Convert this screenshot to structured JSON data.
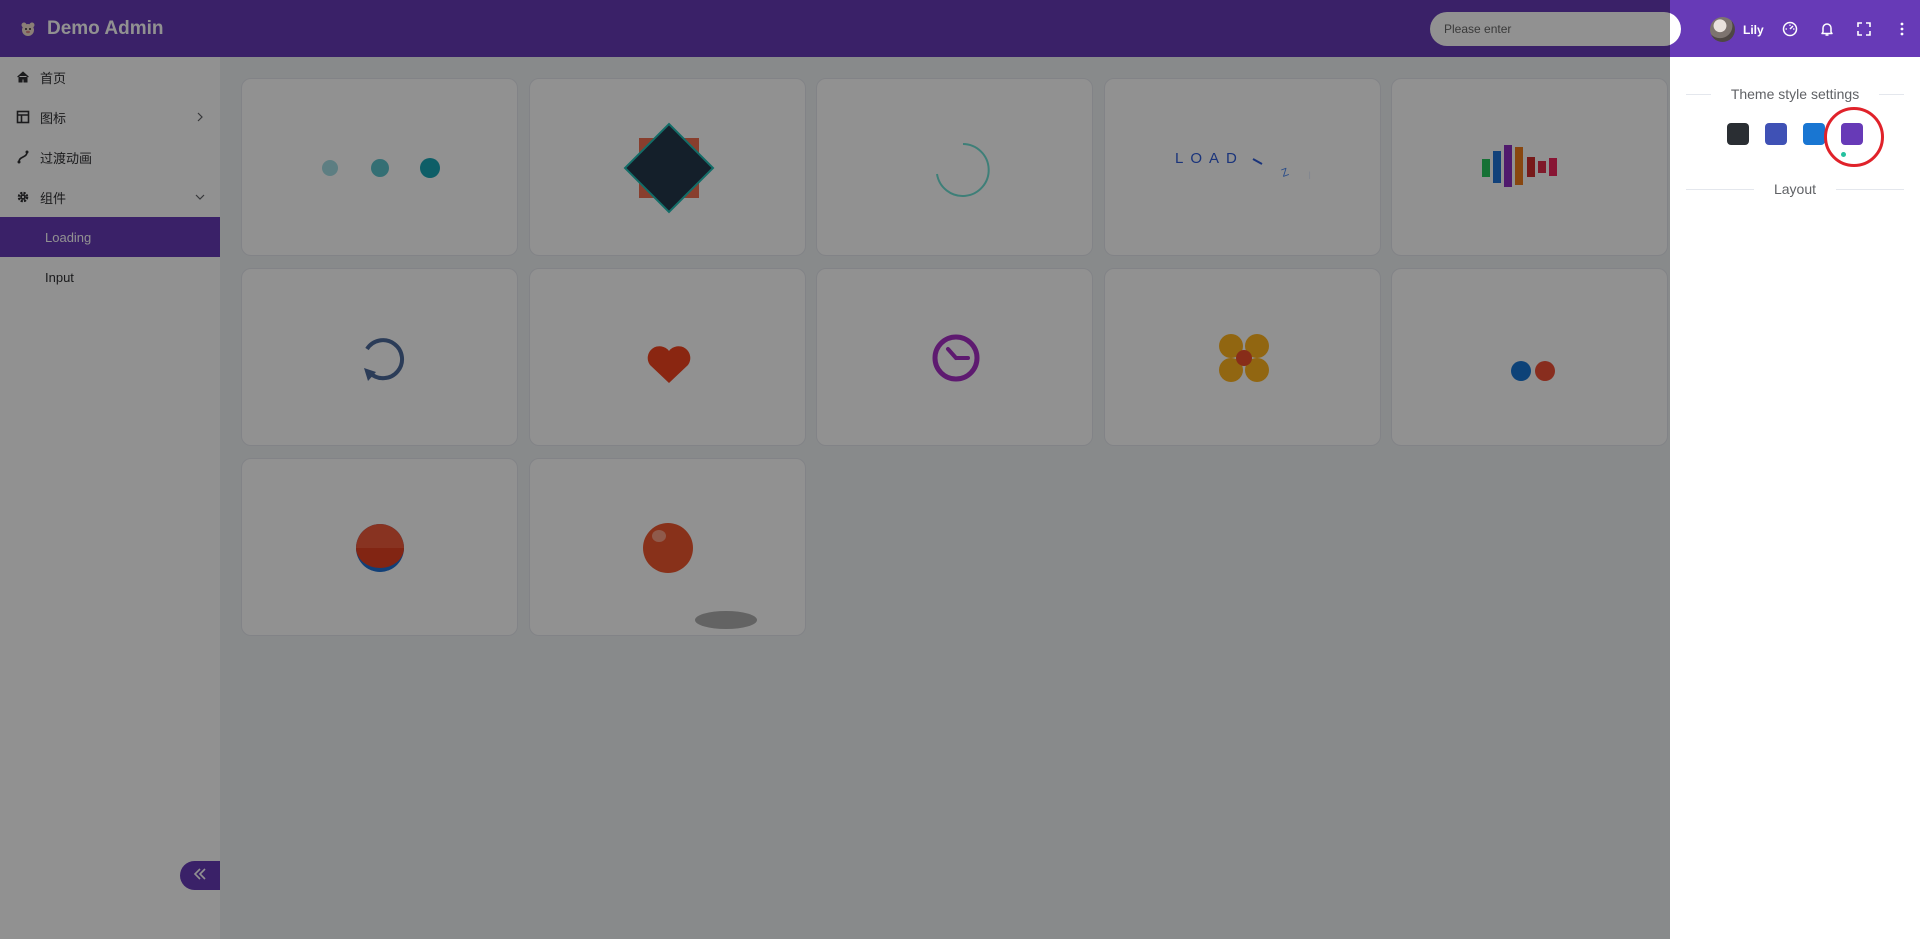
{
  "header": {
    "title": "Demo Admin",
    "search_placeholder": "Please enter",
    "user_name": "Lily",
    "bg_color": "#673ab7"
  },
  "sidebar": {
    "items": [
      {
        "label": "首页",
        "icon": "home-icon"
      },
      {
        "label": "图标",
        "icon": "table-icon",
        "expandable": true
      },
      {
        "label": "过渡动画",
        "icon": "transition-icon"
      },
      {
        "label": "组件",
        "icon": "gear-icon",
        "expanded": true,
        "children": [
          {
            "label": "Loading",
            "active": true
          },
          {
            "label": "Input"
          }
        ]
      }
    ]
  },
  "settings_drawer": {
    "theme_title": "Theme style settings",
    "layout_title": "Layout",
    "themes": [
      {
        "color": "#2a2e33"
      },
      {
        "color": "#3f51b5"
      },
      {
        "color": "#1976d2"
      },
      {
        "color": "#673ab7",
        "selected": true
      }
    ],
    "loading_text": "LOAD"
  },
  "colors": {
    "accent": "#673ab7",
    "annotation": "#e0222a"
  }
}
